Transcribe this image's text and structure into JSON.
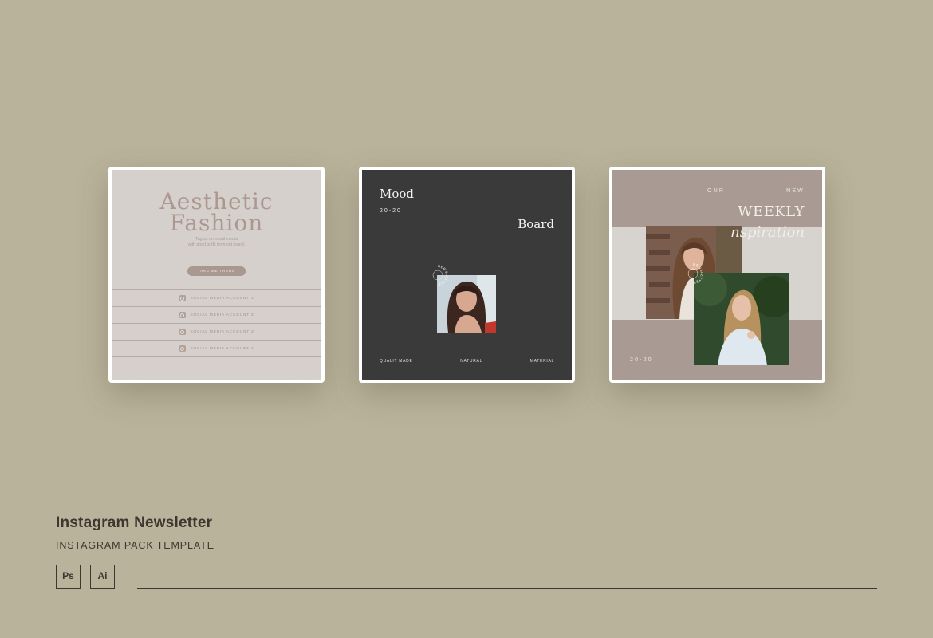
{
  "card_aesthetic": {
    "title_line1": "Aesthetic",
    "title_line2": "Fashion",
    "subtitle_line1": "Tag us on social media",
    "subtitle_line2": "with good outfit from out brand.",
    "button_label": "TAKE ME THERE",
    "accounts": [
      {
        "label": "SOCIAL MEDIA ACCOUNT 1",
        "icon": "instagram-icon"
      },
      {
        "label": "SOCIAL MEDIA ACCOUNT 2",
        "icon": "user-icon"
      },
      {
        "label": "SOCIAL MEDIA ACCOUNT 3",
        "icon": "instagram-icon"
      },
      {
        "label": "SOCIAL MEDIA ACCOUNT 4",
        "icon": "twitter-icon"
      }
    ]
  },
  "card_moodboard": {
    "title_top": "Mood",
    "year": "20-20",
    "title_bottom": "Board",
    "stamp_text": "NEWSLETTER",
    "footer": [
      "QUALIT MADE",
      "NATURAL",
      "MATERIAL"
    ]
  },
  "card_weekly": {
    "our": "OUR",
    "new": "NEW",
    "weekly": "WEEKLY",
    "inspiration": "nspiration",
    "year": "20-20",
    "stamp_text": "NEWSLETTER"
  },
  "info": {
    "title": "Instagram Newsletter",
    "subtitle": "INSTAGRAM PACK TEMPLATE",
    "badges": [
      "Ps",
      "Ai"
    ]
  },
  "colors": {
    "background": "#bab39b",
    "card1_bg": "#d5d0cb",
    "card2_bg": "#3a3a3a",
    "card3_bg": "#a99b93",
    "text_dark": "#3f3630"
  }
}
